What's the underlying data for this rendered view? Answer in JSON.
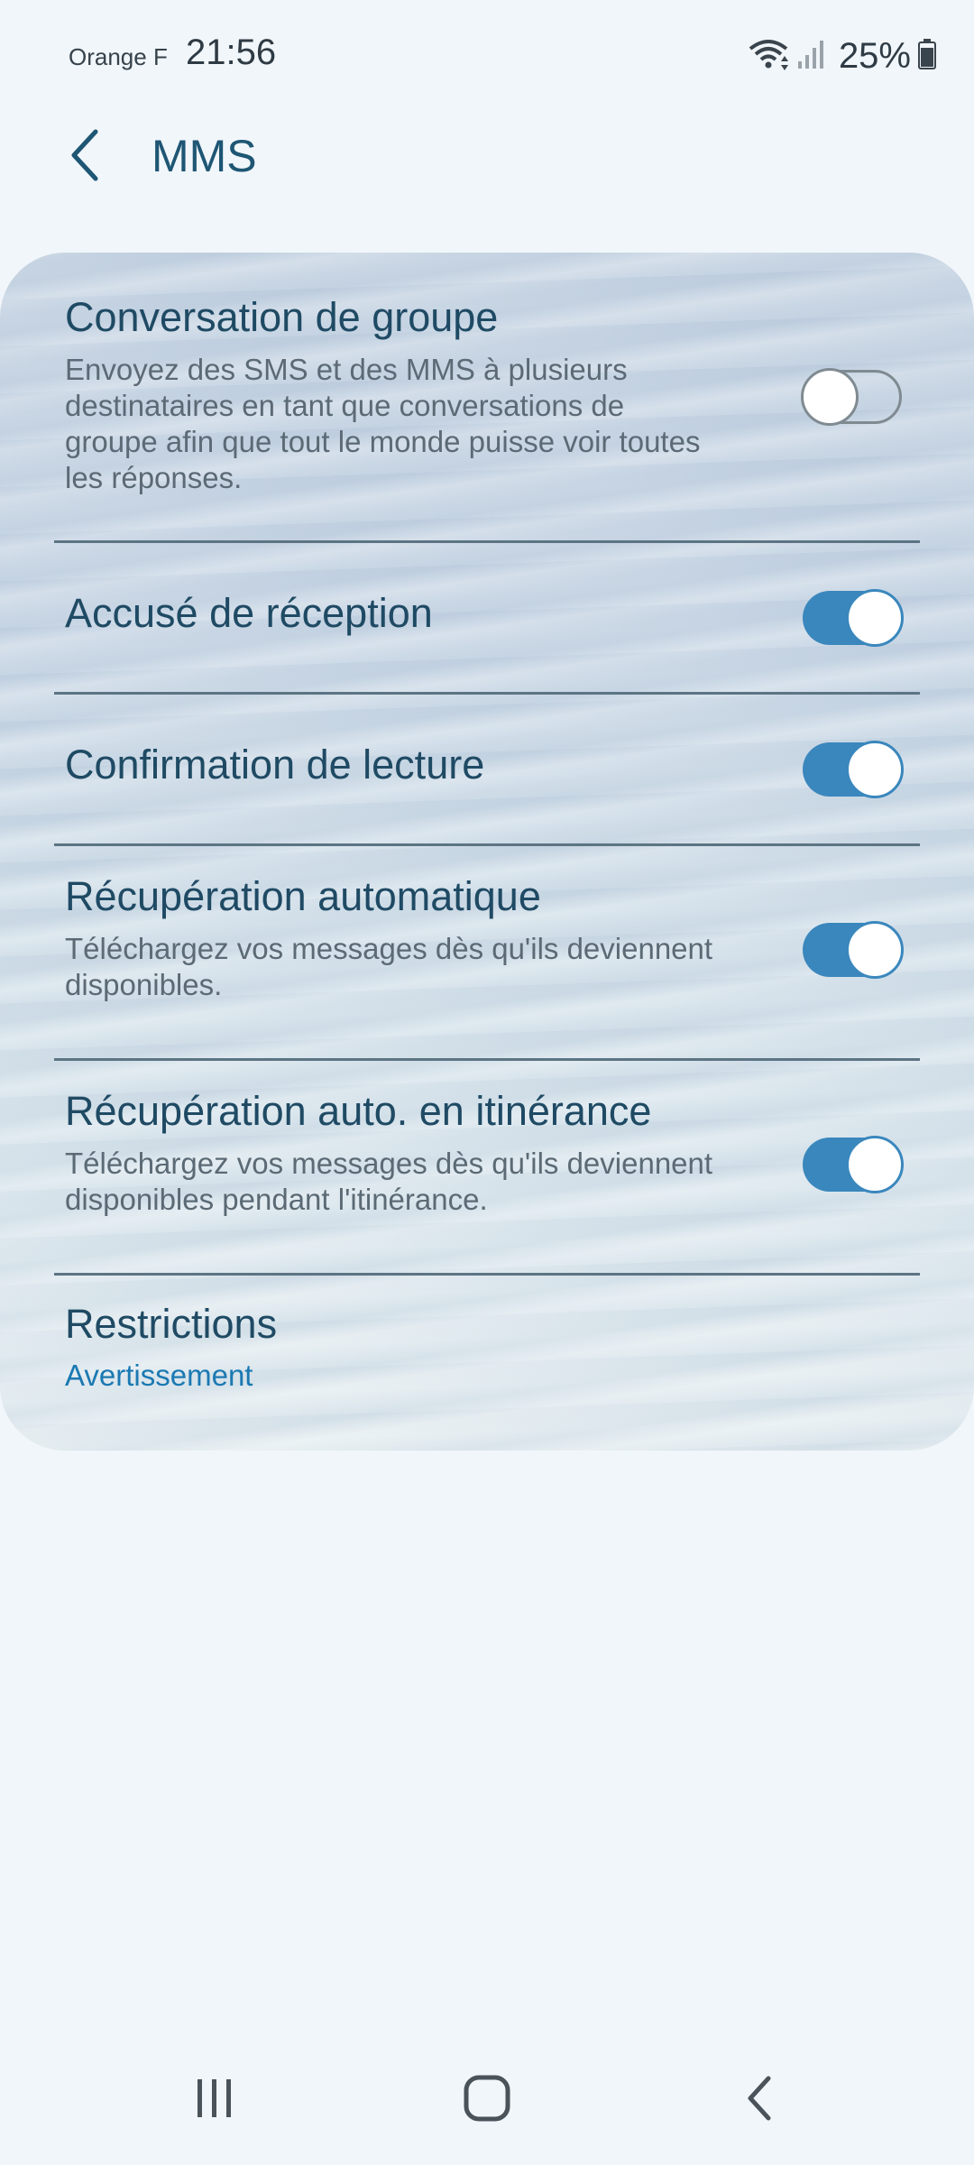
{
  "status_bar": {
    "carrier": "Orange F",
    "time": "21:56",
    "battery": "25%",
    "icons": [
      "wifi-icon",
      "signal-icon",
      "battery-icon"
    ]
  },
  "header": {
    "title": "MMS",
    "back_icon": "back-arrow-icon"
  },
  "settings": [
    {
      "title": "Conversation de groupe",
      "description": "Envoyez des SMS et des MMS à plusieurs destinataires en tant que conversations de groupe afin que tout le monde puisse voir toutes les réponses.",
      "enabled": false
    },
    {
      "title": "Accusé de réception",
      "enabled": true
    },
    {
      "title": "Confirmation de lecture",
      "enabled": true
    },
    {
      "title": "Récupération automatique",
      "description": "Téléchargez vos messages dès qu'ils deviennent disponibles.",
      "enabled": true
    },
    {
      "title": "Récupération auto. en itinérance",
      "description": "Téléchargez vos messages dès qu'ils deviennent disponibles pendant l'itinérance.",
      "enabled": true
    },
    {
      "title": "Restrictions",
      "value": "Avertissement"
    }
  ],
  "navigation_bar": {
    "buttons": [
      "recent-apps-icon",
      "home-icon",
      "back-icon"
    ]
  },
  "colors": {
    "accent": "#3a87bd",
    "title_text": "#1f4a64",
    "link": "#1b79b2",
    "background": "#f1f6fa"
  }
}
